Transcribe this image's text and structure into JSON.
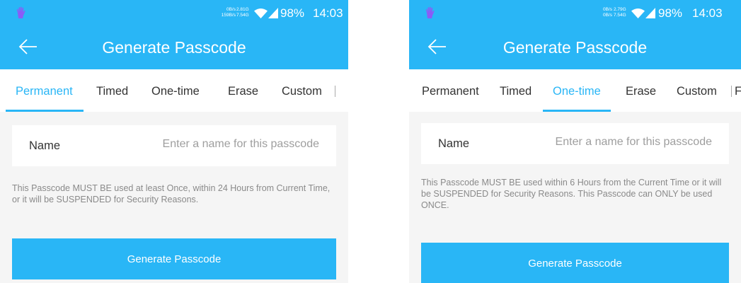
{
  "colors": {
    "primary": "#29b6f6",
    "background": "#f5f5f5",
    "text": "#333333",
    "muted": "#8a8a8a"
  },
  "screens": [
    {
      "status": {
        "net_up": "0B/s",
        "net_down": "159B/s",
        "total_1": "2.81G",
        "total_2": "7.54G",
        "battery": "98%",
        "time": "14:03"
      },
      "title": "Generate Passcode",
      "tabs": [
        "Permanent",
        "Timed",
        "One-time",
        "Erase",
        "Custom"
      ],
      "active_tab": "Permanent",
      "name_label": "Name",
      "name_placeholder": "Enter a name for this passcode",
      "description": "This Passcode MUST BE used at least Once, within 24 Hours from Current Time, or it will be SUSPENDED for Security Reasons.",
      "button_label": "Generate Passcode"
    },
    {
      "status": {
        "net_up": "0B/s",
        "net_down": "0B/s",
        "total_1": "2.79G",
        "total_2": "7.54G",
        "battery": "98%",
        "time": "14:03"
      },
      "title": "Generate Passcode",
      "tabs": [
        "Permanent",
        "Timed",
        "One-time",
        "Erase",
        "Custom"
      ],
      "partial_tab": "F",
      "active_tab": "One-time",
      "name_label": "Name",
      "name_placeholder": "Enter a name for this passcode",
      "description": "This Passcode MUST BE used within 6 Hours from the Current Time or it will be SUSPENDED for Security Reasons. This Passcode can ONLY be used ONCE.",
      "button_label": "Generate Passcode"
    }
  ]
}
